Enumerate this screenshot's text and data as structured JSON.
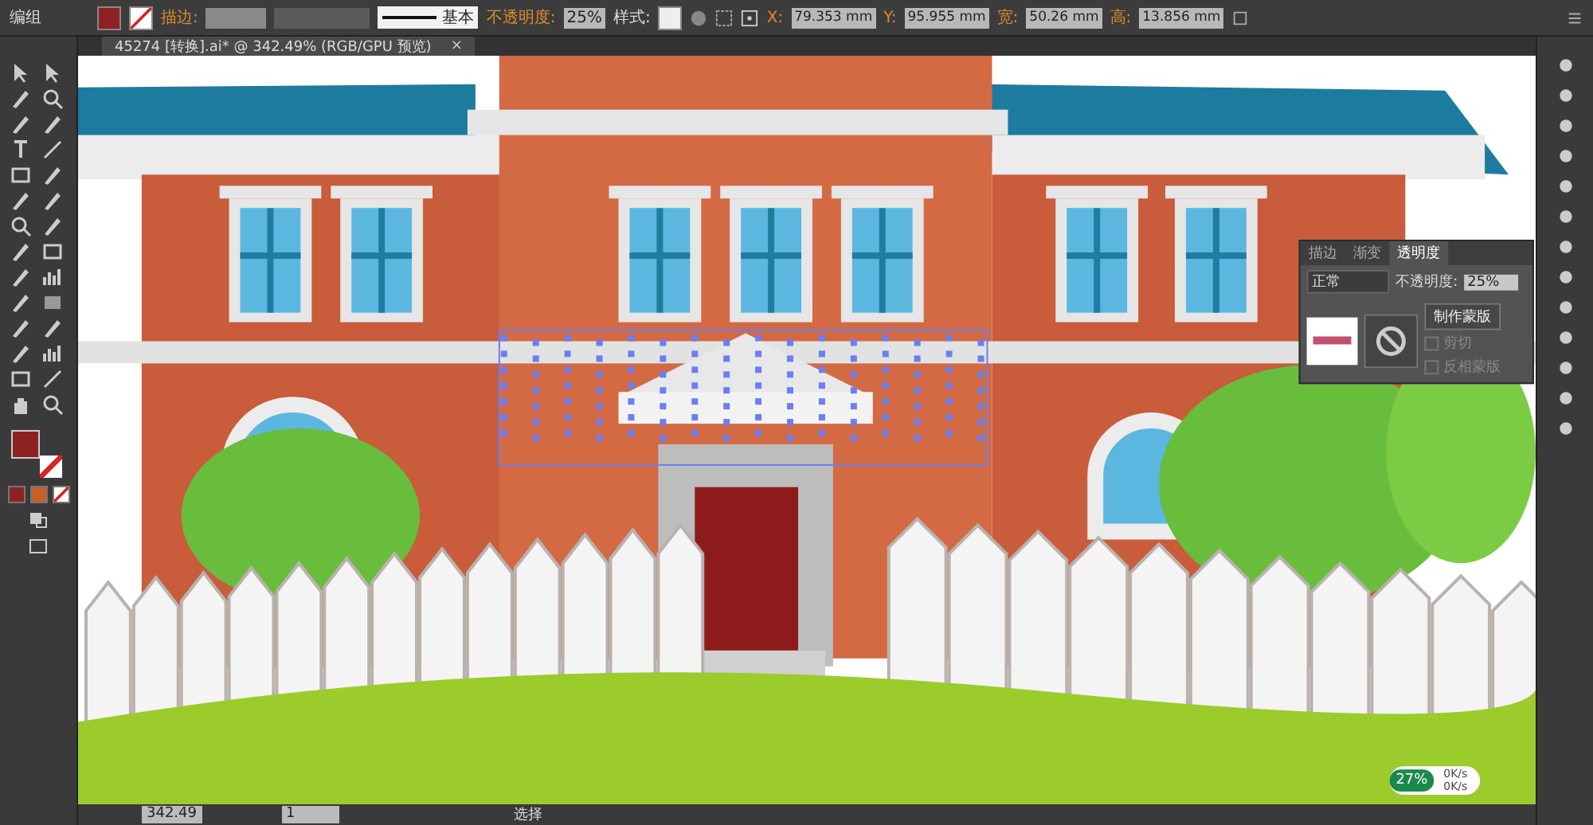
{
  "control_bar": {
    "selection_label": "编组",
    "stroke_label": "描边:",
    "stroke_profile": "基本",
    "opacity_label": "不透明度:",
    "opacity_value": "25%",
    "style_label": "样式:",
    "transform": [
      {
        "label": "X:",
        "value": "79.353 mm"
      },
      {
        "label": "Y:",
        "value": "95.955 mm"
      },
      {
        "label": "宽:",
        "value": "50.26 mm"
      },
      {
        "label": "高:",
        "value": "13.856 mm"
      }
    ]
  },
  "document_tab": {
    "title": "45274 [转换].ai* @ 342.49% (RGB/GPU 预览)",
    "close": "×"
  },
  "transparency_panel": {
    "tabs": [
      {
        "label": "描边",
        "selected": false
      },
      {
        "label": "渐变",
        "selected": false
      },
      {
        "label": "透明度",
        "selected": true
      }
    ],
    "blend_mode": "正常",
    "opacity_label": "不透明度:",
    "opacity_value": "25%",
    "make_mask": "制作蒙版",
    "options": [
      {
        "label": "剪切",
        "checked": false,
        "disabled": true
      },
      {
        "label": "反相蒙版",
        "checked": false,
        "disabled": true
      }
    ]
  },
  "status_bar": {
    "zoom": "342.49",
    "artboard": "1",
    "tool": "选择"
  },
  "network_widget": {
    "cpu": "27%",
    "upload": "0K/s",
    "download": "0K/s"
  }
}
